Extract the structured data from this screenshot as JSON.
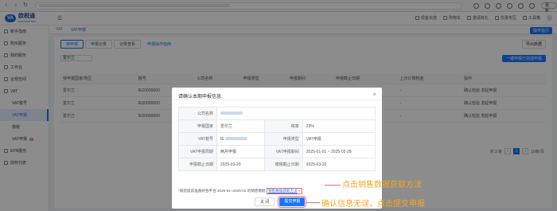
{
  "browser": {
    "update_label": "更新"
  },
  "header": {
    "logo_cn": "欧税通",
    "logo_en": "EVATMASTER",
    "items": [
      "现金充值",
      "购物车",
      "邀请有礼",
      "优惠专区",
      "工具箱"
    ],
    "action_button": "操作指引"
  },
  "sidebar": {
    "items": [
      {
        "label": "新手指南",
        "sub": false,
        "active": false
      },
      {
        "label": "购买服务",
        "sub": false,
        "active": false
      },
      {
        "label": "我的服务",
        "sub": false,
        "active": false
      },
      {
        "label": "工作台",
        "sub": false,
        "active": false
      },
      {
        "label": "合规空间",
        "sub": false,
        "active": false
      },
      {
        "label": "VAT",
        "sub": false,
        "active": false
      },
      {
        "label": "VAT税号",
        "sub": true,
        "active": false
      },
      {
        "label": "VAT申报",
        "sub": true,
        "active": true
      },
      {
        "label": "缴税",
        "sub": true,
        "active": false
      },
      {
        "label": "VAT申报",
        "sub": true,
        "active": false,
        "badge": "新"
      },
      {
        "label": "EPR服务",
        "sub": false,
        "active": false
      },
      {
        "label": "授权代表",
        "sub": false,
        "active": false
      }
    ]
  },
  "breadcrumb": [
    "VAT",
    "VAT申报"
  ],
  "page": {
    "ghost_button": "导出数据",
    "tabs": [
      "待申报",
      "申报记录",
      "记录查看"
    ],
    "link": "申报操作指南",
    "filter_country": "爱尔兰",
    "primary_button": "一键申报已完成申报"
  },
  "table": {
    "columns": [
      "待申报国家/地区",
      "税号",
      "公司名称",
      "申报类型",
      "申报期间",
      "申报截止日期",
      "上次计算税金",
      "操作"
    ],
    "rows": [
      [
        "爱尔兰",
        "IE00000000",
        "",
        "",
        "",
        "",
        "-",
        "确认检验  发起申报"
      ],
      [
        "爱尔兰",
        "IE00000000",
        "",
        "",
        "",
        "",
        "-",
        "确认检验  发起申报"
      ],
      [
        "爱尔兰",
        "IE00000000",
        "",
        "",
        "",
        "",
        "-",
        "确认检验  发起申报"
      ]
    ],
    "pagination": {
      "total": "共 3 条",
      "page": "1",
      "size": "10条/页"
    }
  },
  "modal": {
    "title": "请确认本期申报信息",
    "close": "×",
    "rows": [
      {
        "l1": "公司名称",
        "v1": "",
        "l2": "",
        "v2": ""
      },
      {
        "l1": "申报国家",
        "v1": "爱尔兰",
        "l2": "税率",
        "v2": "23%"
      },
      {
        "l1": "VAT税号",
        "v1": "IE",
        "l2": "申报类型",
        "v2": "VAT申报"
      },
      {
        "l1": "VAT申报周期",
        "v1": "两月申报",
        "l2": "VAT申报期间",
        "v2": "2025-01-01 ~ 2025-02-28"
      },
      {
        "l1": "申报截止日期",
        "v1": "2025-03-20",
        "l2": "缴税截止日期",
        "v2": "2025-03-20"
      }
    ],
    "note_prefix": "*请您提前准备好各平台 2025-01~2025-02 的销售数据",
    "note_link": "销售数据获取方法",
    "note_suffix": "»",
    "cancel": "关 闭",
    "confirm": "提交申报"
  },
  "annotations": {
    "top": "点击销售数据获取方法",
    "bottom": "确认信息无误，点击提交申报"
  }
}
